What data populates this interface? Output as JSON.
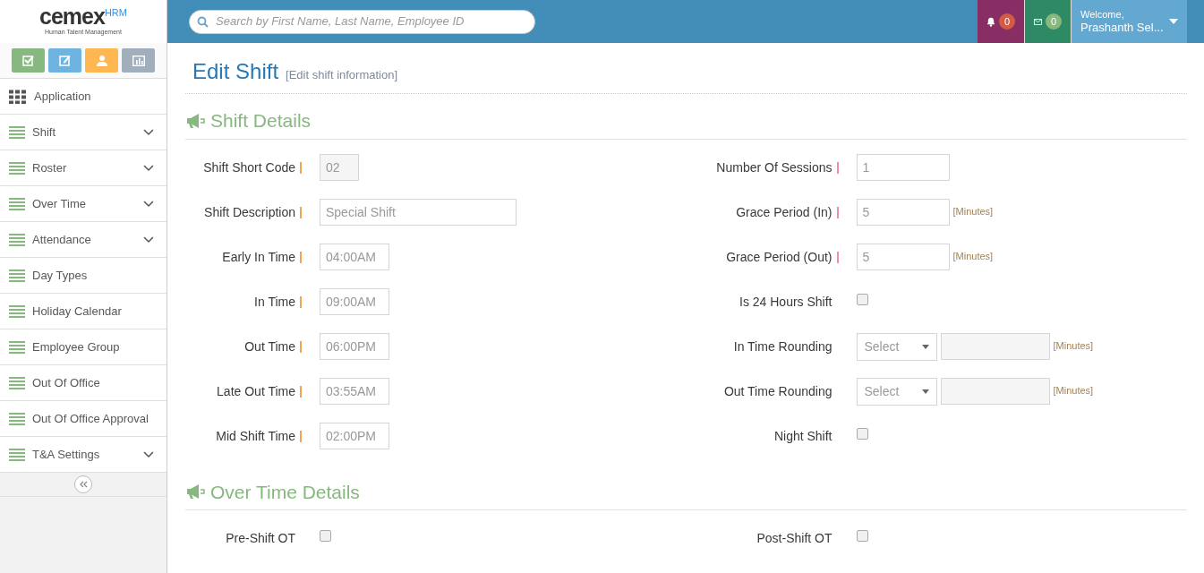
{
  "brand": {
    "name": "cemex",
    "badge": "HRM",
    "tagline": "Human Talent Management"
  },
  "quick_buttons": [
    {
      "kind": "tasks",
      "color": "#87b87f"
    },
    {
      "kind": "edit",
      "color": "#6fb3e0"
    },
    {
      "kind": "user",
      "color": "#ffb752"
    },
    {
      "kind": "chart",
      "color": "#a0afbb"
    }
  ],
  "sidebar": {
    "items": [
      {
        "label": "Application",
        "kind": "grid",
        "expandable": false
      },
      {
        "label": "Shift",
        "kind": "list",
        "expandable": true
      },
      {
        "label": "Roster",
        "kind": "list",
        "expandable": true
      },
      {
        "label": "Over Time",
        "kind": "list",
        "expandable": true
      },
      {
        "label": "Attendance",
        "kind": "list",
        "expandable": true
      },
      {
        "label": "Day Types",
        "kind": "list",
        "expandable": false
      },
      {
        "label": "Holiday Calendar",
        "kind": "list",
        "expandable": false
      },
      {
        "label": "Employee Group",
        "kind": "list",
        "expandable": false
      },
      {
        "label": "Out Of Office",
        "kind": "list",
        "expandable": false
      },
      {
        "label": "Out Of Office Approval",
        "kind": "list",
        "expandable": false
      },
      {
        "label": "T&A Settings",
        "kind": "list",
        "expandable": true
      }
    ]
  },
  "search": {
    "placeholder": "Search by First Name, Last Name, Employee ID"
  },
  "notifications": {
    "count": "0"
  },
  "messages": {
    "count": "0"
  },
  "user": {
    "greeting": "Welcome,",
    "name": "Prashanth Sel..."
  },
  "page": {
    "title": "Edit Shift",
    "subtitle": "[Edit shift information]"
  },
  "sections": [
    {
      "title": "Shift Details",
      "columns": [
        [
          {
            "label": "Shift Short Code",
            "required": true,
            "kind": "code",
            "value": "02",
            "readonly": true
          },
          {
            "label": "Shift Description",
            "required": true,
            "kind": "wide",
            "value": "Special Shift"
          },
          {
            "label": "Early In Time",
            "required": true,
            "kind": "time",
            "value": "04:00AM"
          },
          {
            "label": "In Time",
            "required": true,
            "kind": "time",
            "value": "09:00AM"
          },
          {
            "label": "Out Time",
            "required": true,
            "kind": "time",
            "value": "06:00PM"
          },
          {
            "label": "Late Out Time",
            "required": true,
            "kind": "time",
            "value": "03:55AM"
          },
          {
            "label": "Mid Shift Time",
            "required": true,
            "kind": "time",
            "value": "02:00PM"
          }
        ],
        [
          {
            "label": "Number Of Sessions",
            "required": true,
            "kind": "number",
            "value": "1"
          },
          {
            "label": "Grace Period (In)",
            "required": true,
            "kind": "number",
            "value": "5",
            "unit": "[Minutes]"
          },
          {
            "label": "Grace Period (Out)",
            "required": true,
            "kind": "number",
            "value": "5",
            "unit": "[Minutes]"
          },
          {
            "label": "Is 24 Hours Shift",
            "required": false,
            "kind": "checkbox",
            "checked": false
          },
          {
            "label": "In Time Rounding",
            "required": false,
            "kind": "rounding",
            "select": "Select",
            "unit": "[Minutes]"
          },
          {
            "label": "Out Time Rounding",
            "required": false,
            "kind": "rounding",
            "select": "Select",
            "unit": "[Minutes]"
          },
          {
            "label": "Night Shift",
            "required": false,
            "kind": "checkbox",
            "checked": false
          }
        ]
      ]
    },
    {
      "title": "Over Time Details",
      "columns": [
        [
          {
            "label": "Pre-Shift OT",
            "required": false,
            "kind": "checkbox",
            "checked": false
          }
        ],
        [
          {
            "label": "Post-Shift OT",
            "required": false,
            "kind": "checkbox",
            "checked": false
          }
        ]
      ]
    }
  ]
}
